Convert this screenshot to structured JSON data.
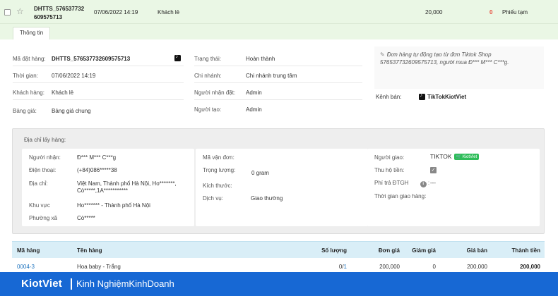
{
  "summary_row": {
    "code_line1": "DHTTS_576537732",
    "code_line2": "609575713",
    "time": "07/06/2022 14:19",
    "customer": "Khách lẻ",
    "total": "20,000",
    "paid": "0",
    "payment_type": "Phiếu tạm"
  },
  "tabs": {
    "info": "Thông tin"
  },
  "info": {
    "order_code_label": "Mã đặt hàng:",
    "order_code": "DHTTS_576537732609575713",
    "time_label": "Thời gian:",
    "time": "07/06/2022 14:19",
    "customer_label": "Khách hàng:",
    "customer": "Khách lẻ",
    "price_list_label": "Bảng giá:",
    "price_list": "Bảng giá chung",
    "status_label": "Trạng thái:",
    "status": "Hoàn thành",
    "branch_label": "Chi nhánh:",
    "branch": "Chi nhánh trung tâm",
    "receiver_label": "Người nhận đặt:",
    "receiver": "Admin",
    "creator_label": "Người tạo:",
    "creator": "Admin",
    "note_line1": "Đơn hàng tự động tạo từ đơn Tiktok Shop",
    "note_line2": "576537732609575713, người mua Đ*** M*** C***g.",
    "channel_label": "Kênh bán:",
    "channel": "TikTokKiotViet"
  },
  "shipping": {
    "title": "Địa chỉ lấy hàng:",
    "recipient_label": "Người nhận:",
    "recipient": "Đ*** M*** C***g",
    "phone_label": "Điện thoại:",
    "phone": "(+84)086*****38",
    "address_label": "Địa chỉ:",
    "address_line1": "Việt Nam, Thành phố Hà Nội, Ho*******,",
    "address_line2": "Cò*****,1A***********",
    "area_label": "Khu vực",
    "area": "Ho******* - Thành phố Hà Nội",
    "ward_label": "Phường xã",
    "ward": "Cò*****",
    "tracking_label": "Mã vận đơn:",
    "tracking": "",
    "weight_label": "Trọng lượng:",
    "weight": "0 gram",
    "size_label": "Kích thước:",
    "size": "",
    "service_label": "Dịch vụ:",
    "service": "Giao thường",
    "carrier_label": "Người giao:",
    "carrier": "TIKTOK",
    "carrier_badge": "KiotViet",
    "cod_label": "Thu hộ tiền:",
    "cod_checked": true,
    "fee_label": "Phí trả ĐTGH",
    "fee": "---",
    "delivery_time_label": "Thời gian giao hàng:"
  },
  "product_table": {
    "headers": [
      "Mã hàng",
      "Tên hàng",
      "Số lượng",
      "Đơn giá",
      "Giảm giá",
      "Giá bán",
      "Thành tiền"
    ],
    "rows": [
      {
        "code": "0004-3",
        "name": "Hoa baby - Trắng",
        "qty_done": "0",
        "qty_sep": "/",
        "qty_total": "1",
        "unit_price": "200,000",
        "discount": "0",
        "price": "200,000",
        "amount": "200,000"
      }
    ]
  },
  "footer": {
    "brand": "KiotViet",
    "tagline": "Kinh NghiệmKinhDoanh"
  },
  "colors": {
    "row_highlight": "#eaf7e5",
    "table_header": "#d9eef7",
    "footer_bg": "#1768d4",
    "link": "#1e73be",
    "paid_red": "#e74c3c",
    "badge_green": "#2ebd59"
  }
}
